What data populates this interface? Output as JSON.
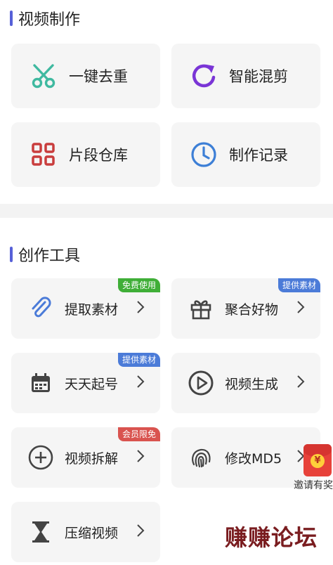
{
  "video_making": {
    "title": "视频制作",
    "items": [
      {
        "label": "一键去重",
        "icon": "scissors-icon",
        "color": "#3fb9a0"
      },
      {
        "label": "智能混剪",
        "icon": "refresh-icon",
        "color": "#7a35d6"
      },
      {
        "label": "片段仓库",
        "icon": "grid-icon",
        "color": "#c93d3d"
      },
      {
        "label": "制作记录",
        "icon": "clock-icon",
        "color": "#3d7fd6"
      }
    ]
  },
  "creation_tools": {
    "title": "创作工具",
    "items": [
      {
        "label": "提取素材",
        "icon": "paperclip-icon",
        "badge": "免费使用",
        "badge_color": "#3fae37"
      },
      {
        "label": "聚合好物",
        "icon": "gift-icon",
        "badge": "提供素材",
        "badge_color": "#4b7bd8"
      },
      {
        "label": "天天起号",
        "icon": "calendar-icon",
        "badge": "提供素材",
        "badge_color": "#4b7bd8"
      },
      {
        "label": "视频生成",
        "icon": "play-circle-icon",
        "badge": "",
        "badge_color": ""
      },
      {
        "label": "视频拆解",
        "icon": "plus-circle-icon",
        "badge": "会员限免",
        "badge_color": "#d9534f"
      },
      {
        "label": "修改MD5",
        "icon": "fingerprint-icon",
        "badge": "",
        "badge_color": ""
      },
      {
        "label": "压缩视频",
        "icon": "hourglass-icon",
        "badge": "",
        "badge_color": ""
      }
    ]
  },
  "invite_float": {
    "label": "邀请有奖",
    "coin": "¥"
  },
  "watermark": "赚赚论坛"
}
